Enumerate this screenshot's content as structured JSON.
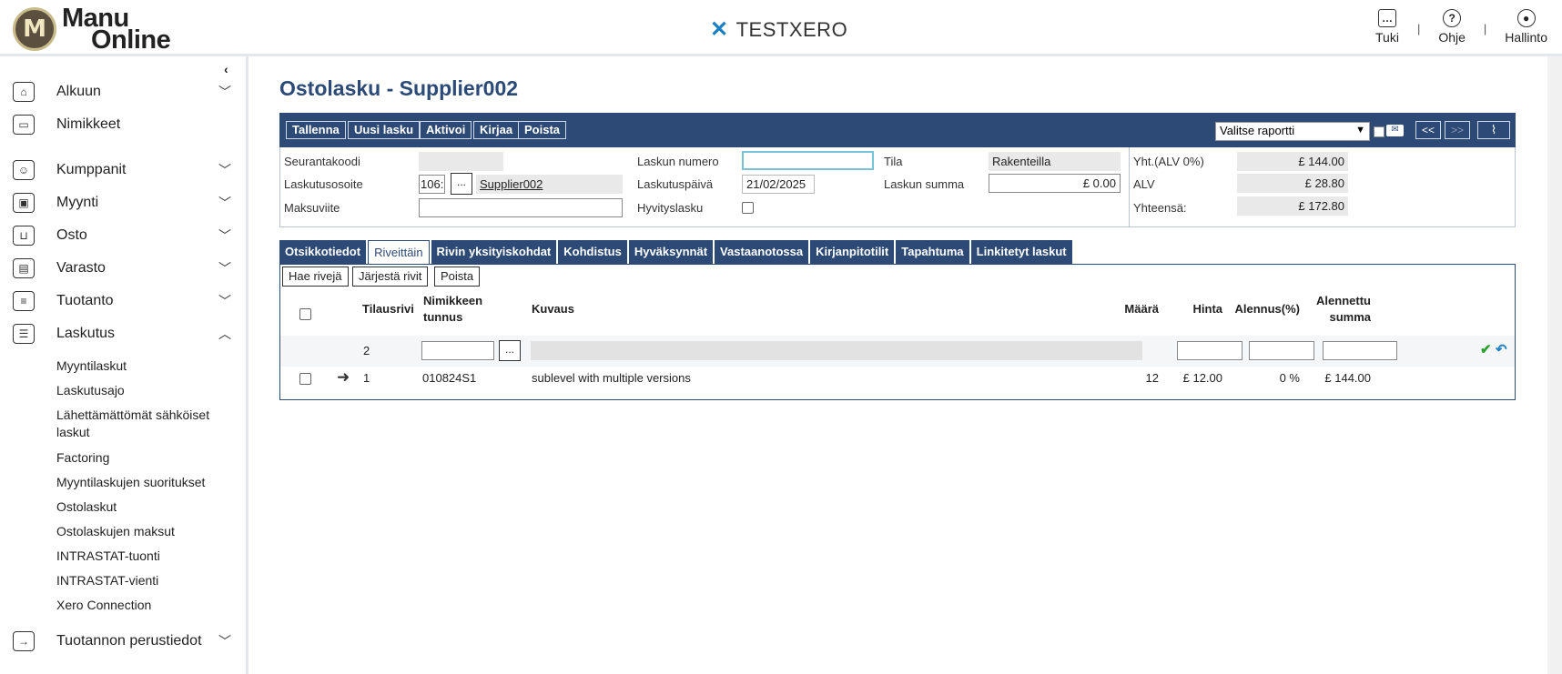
{
  "header": {
    "logo_line1": "Manu",
    "logo_line2": "Online",
    "logo_letter": "M",
    "company": "TESTXERO",
    "links": [
      {
        "label": "Tuki",
        "icon": "chat-icon"
      },
      {
        "label": "Ohje",
        "icon": "help-icon"
      },
      {
        "label": "Hallinto",
        "icon": "user-icon"
      }
    ],
    "separator": "|"
  },
  "sidebar": {
    "collapse_glyph": "‹",
    "items": [
      {
        "label": "Alkuun",
        "icon": "home-icon",
        "glyph": "⌂",
        "expanded": false
      },
      {
        "label": "Nimikkeet",
        "icon": "inbox-icon",
        "glyph": "▭"
      },
      {
        "label": "Kumppanit",
        "icon": "contacts-icon",
        "glyph": "☺",
        "expanded": false
      },
      {
        "label": "Myynti",
        "icon": "wallet-icon",
        "glyph": "▣",
        "expanded": false
      },
      {
        "label": "Osto",
        "icon": "basket-icon",
        "glyph": "⊔",
        "expanded": false
      },
      {
        "label": "Varasto",
        "icon": "warehouse-icon",
        "glyph": "▤",
        "expanded": false
      },
      {
        "label": "Tuotanto",
        "icon": "database-icon",
        "glyph": "≡",
        "expanded": false
      },
      {
        "label": "Laskutus",
        "icon": "document-icon",
        "glyph": "☰",
        "expanded": true
      },
      {
        "label": "Tuotannon perustiedot",
        "icon": "exit-icon",
        "glyph": "→",
        "expanded": false
      }
    ],
    "subitems": [
      "Myyntilaskut",
      "Laskutusajo",
      "Lähettämättömät sähköiset laskut",
      "Factoring",
      "Myyntilaskujen suoritukset",
      "Ostolaskut",
      "Ostolaskujen maksut",
      "INTRASTAT-tuonti",
      "INTRASTAT-vienti",
      "Xero Connection"
    ]
  },
  "page": {
    "title": "Ostolasku - Supplier002"
  },
  "toolbar": {
    "buttons": [
      "Tallenna",
      "Uusi lasku",
      "Aktivoi",
      "Kirjaa",
      "Poista"
    ],
    "report_select": "Valitse raportti",
    "prev": "<<",
    "next": ">>",
    "attach_icon": "paperclip-icon"
  },
  "form": {
    "seurantakoodi_label": "Seurantakoodi",
    "seurantakoodi_value": "",
    "laskutusosoite_label": "Laskutusosoite",
    "laskutusosoite_code": "106:",
    "laskutusosoite_btn": "...",
    "laskutusosoite_name": "Supplier002",
    "maksuviite_label": "Maksuviite",
    "maksuviite_value": "",
    "laskun_numero_label": "Laskun numero",
    "laskun_numero_value": "",
    "laskutuspaiva_label": "Laskutuspäivä",
    "laskutuspaiva_value": "21/02/2025",
    "hyvityslasku_label": "Hyvityslasku",
    "hyvityslasku_checked": false,
    "tila_label": "Tila",
    "tila_value": "Rakenteilla",
    "laskun_summa_label": "Laskun summa",
    "laskun_summa_value": "£ 0.00",
    "yht_label": "Yht.(ALV 0%)",
    "yht_value": "£ 144.00",
    "alv_label": "ALV",
    "alv_value": "£ 28.80",
    "yhteensa_label": "Yhteensä:",
    "yhteensa_value": "£ 172.80"
  },
  "tabs": [
    {
      "label": "Otsikkotiedot",
      "active": false
    },
    {
      "label": "Riveittäin",
      "active": true
    },
    {
      "label": "Rivin yksityiskohdat",
      "active": false
    },
    {
      "label": "Kohdistus",
      "active": false
    },
    {
      "label": "Hyväksynnät",
      "active": false
    },
    {
      "label": "Vastaanotossa",
      "active": false
    },
    {
      "label": "Kirjanpitotilit",
      "active": false
    },
    {
      "label": "Tapahtuma",
      "active": false
    },
    {
      "label": "Linkitetyt laskut",
      "active": false
    }
  ],
  "grid": {
    "buttons": [
      "Hae rivejä",
      "Järjestä rivit",
      "Poista"
    ],
    "headers": {
      "tilausrivi": "Tilausrivi",
      "nimikkeen_tunnus": "Nimikkeen tunnus",
      "kuvaus": "Kuvaus",
      "maara": "Määrä",
      "hinta": "Hinta",
      "alennus": "Alennus(%)",
      "alennettu_summa": "Alennettu summa"
    },
    "new_row": {
      "tilausrivi": "2",
      "btn": "..."
    },
    "rows": [
      {
        "tilausrivi": "1",
        "nimikkeen_tunnus": "010824S1",
        "kuvaus": "sublevel with multiple versions",
        "maara": "12",
        "hinta": "£ 12.00",
        "alennus": "0 %",
        "alennettu_summa": "£ 144.00"
      }
    ]
  }
}
